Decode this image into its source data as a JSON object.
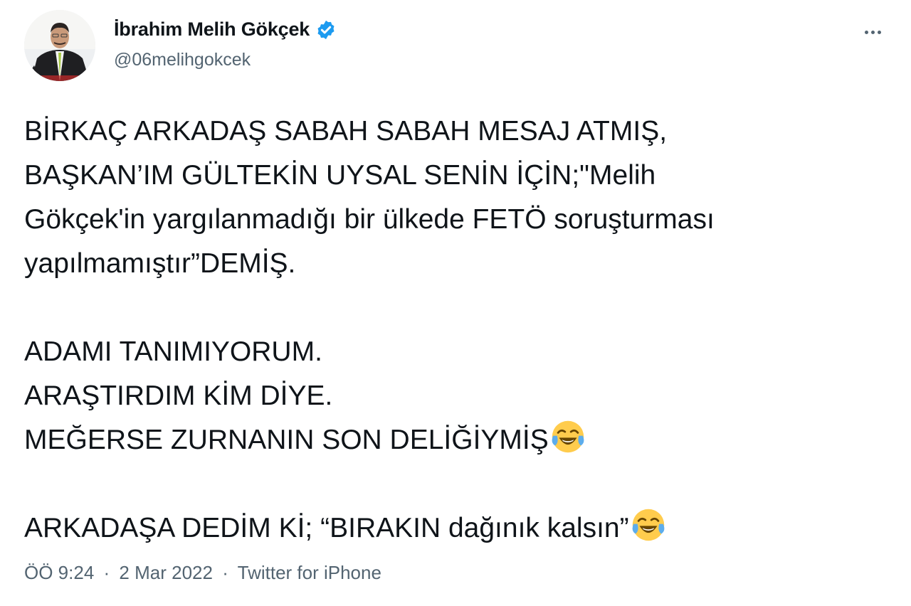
{
  "author": {
    "display_name": "İbrahim Melih Gökçek",
    "handle": "@06melihgokcek",
    "verified_icon": "verified-badge-icon",
    "avatar": "profile-photo"
  },
  "menu_icon": "more-options-icon",
  "tweet": {
    "paragraphs": [
      {
        "lines": [
          "BİRKAÇ ARKADAŞ SABAH SABAH MESAJ ATMIŞ,",
          "BAŞKAN’IM GÜLTEKİN UYSAL SENİN İÇİN;\"Melih",
          "Gökçek'in yargılanmadığı bir ülkede FETÖ soruşturması",
          "yapılmamıştır”DEMİŞ."
        ]
      },
      {
        "lines": [
          "ADAMI TANIMIYORUM.",
          "ARAŞTIRDIM KİM DİYE.",
          "MEĞERSE ZURNANIN SON DELİĞİYMİŞ"
        ],
        "trailing_emoji": "face-with-tears-of-joy"
      },
      {
        "lines": [
          "ARKADAŞA DEDİM Kİ; “BIRAKIN dağınık kalsın”"
        ],
        "trailing_emoji": "face-with-tears-of-joy"
      }
    ]
  },
  "meta": {
    "time": "ÖÖ 9:24",
    "separator": "·",
    "date": "2 Mar 2022",
    "source": "Twitter for iPhone"
  },
  "colors": {
    "text": "#0f1419",
    "secondary": "#536471",
    "verified": "#1d9bf0"
  }
}
